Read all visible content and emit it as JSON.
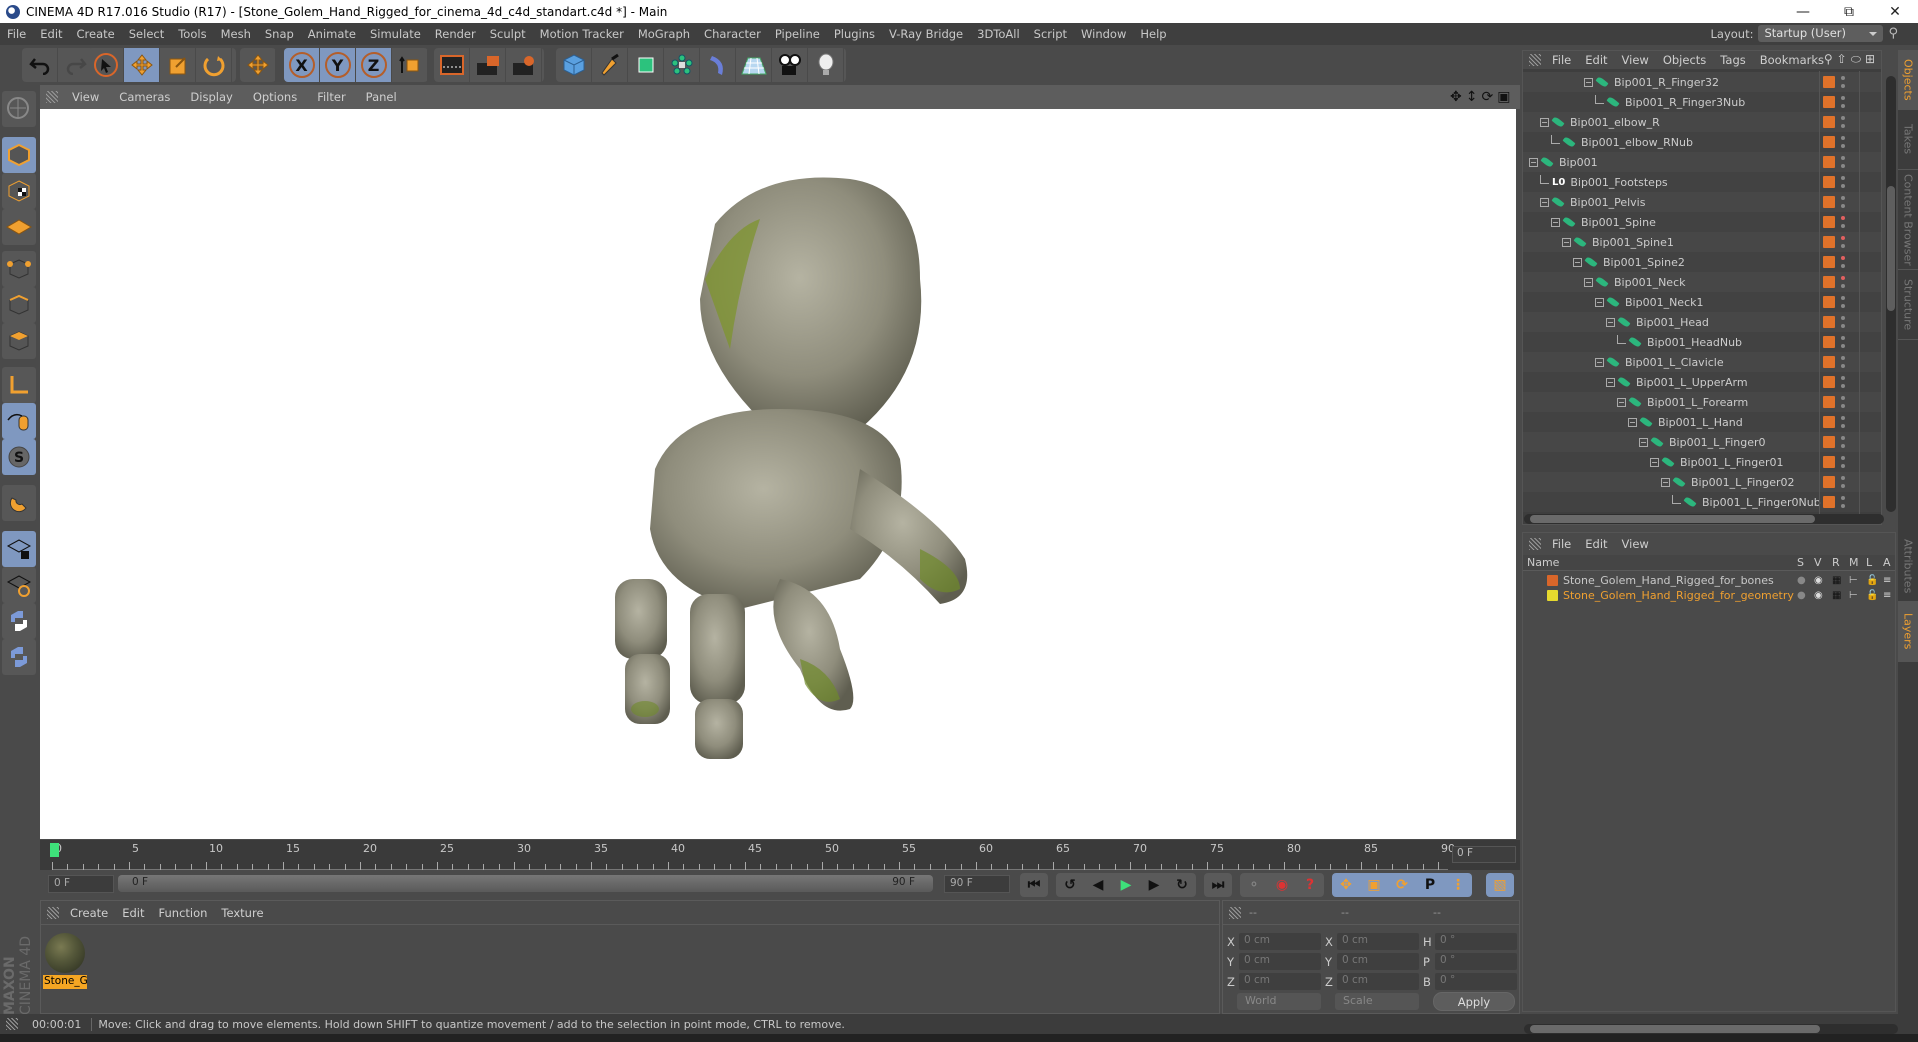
{
  "window": {
    "title": "CINEMA 4D R17.016 Studio (R17) - [Stone_Golem_Hand_Rigged_for_cinema_4d_c4d_standart.c4d *] - Main",
    "controls": [
      "minimize",
      "restore",
      "close"
    ]
  },
  "menubar": [
    "File",
    "Edit",
    "Create",
    "Select",
    "Tools",
    "Mesh",
    "Snap",
    "Animate",
    "Simulate",
    "Render",
    "Sculpt",
    "Motion Tracker",
    "MoGraph",
    "Character",
    "Pipeline",
    "Plugins",
    "V-Ray Bridge",
    "3DToAll",
    "Script",
    "Window",
    "Help"
  ],
  "layout": {
    "label": "Layout:",
    "value": "Startup (User)"
  },
  "toolbar": {
    "groups": [
      {
        "items": [
          "undo-icon",
          "redo-icon"
        ]
      },
      {
        "items": [
          "select-pointer-icon",
          "move-icon",
          "scale-icon",
          "rotate-icon"
        ],
        "active": [
          "move-icon"
        ]
      },
      {
        "items": [
          "last-tool-move-icon"
        ]
      },
      {
        "items": [
          "x-axis-icon",
          "y-axis-icon",
          "z-axis-icon",
          "coordinate-system-icon"
        ],
        "active": [
          "x-axis-icon",
          "y-axis-icon",
          "z-axis-icon"
        ]
      },
      {
        "items": [
          "render-view-icon",
          "render-picture-viewer-icon",
          "render-settings-icon"
        ]
      },
      {
        "items": [
          "cube-icon",
          "pen-spline-icon",
          "subdivision-icon",
          "array-icon",
          "deformer-icon",
          "floor-icon",
          "camera-icon",
          "light-icon"
        ]
      }
    ],
    "labels": {
      "x": "X",
      "y": "Y",
      "z": "Z"
    }
  },
  "lefttools": [
    "make-editable-icon",
    "model-mode-icon",
    "texture-mode-icon",
    "workplane-mode-icon",
    "points-mode-icon",
    "edges-mode-icon",
    "polygons-mode-icon",
    "axis-mode-icon",
    "tweak-mode-icon",
    "solo-icon",
    "snap-magnet-icon",
    "lock-workplane-icon",
    "workplane-align-icon",
    "python-icon",
    "python-script-icon"
  ],
  "viewport": {
    "menu": [
      "View",
      "Cameras",
      "Display",
      "Options",
      "Filter",
      "Panel"
    ],
    "nav_icons": [
      "move-view-icon",
      "zoom-view-icon",
      "rotate-view-icon",
      "toggle-view-icon"
    ]
  },
  "timeline": {
    "ticks": [
      "0",
      "5",
      "10",
      "15",
      "20",
      "25",
      "30",
      "35",
      "40",
      "45",
      "50",
      "55",
      "60",
      "65",
      "70",
      "75",
      "80",
      "85",
      "90"
    ],
    "current_frame": "0 F",
    "start_field": "0 F",
    "range_start": "0 F",
    "range_end": "90 F",
    "end_field": "90 F"
  },
  "material_manager": {
    "menu": [
      "Create",
      "Edit",
      "Function",
      "Texture"
    ],
    "materials": [
      {
        "name": "Stone_G"
      }
    ]
  },
  "brand": {
    "maxon": "MAXON",
    "product": "CINEMA 4D"
  },
  "coordinates": {
    "headers": [
      "--",
      "--",
      "--"
    ],
    "rows": [
      {
        "l1": "X",
        "v1": "0 cm",
        "l2": "X",
        "v2": "0 cm",
        "l3": "H",
        "v3": "0 °"
      },
      {
        "l1": "Y",
        "v1": "0 cm",
        "l2": "Y",
        "v2": "0 cm",
        "l3": "P",
        "v3": "0 °"
      },
      {
        "l1": "Z",
        "v1": "0 cm",
        "l2": "Z",
        "v2": "0 cm",
        "l3": "B",
        "v3": "0 °"
      }
    ],
    "space": "World",
    "mode": "Scale",
    "apply": "Apply"
  },
  "status": {
    "time": "00:00:01",
    "message": "Move: Click and drag to move elements. Hold down SHIFT to quantize movement / add to the selection in point mode, CTRL to remove."
  },
  "object_manager": {
    "menu": [
      "File",
      "Edit",
      "View",
      "Objects",
      "Tags",
      "Bookmarks"
    ],
    "objects": [
      {
        "name": "Bip001_R_Finger32",
        "depth": 5,
        "type": "bone",
        "exp": true,
        "red": false
      },
      {
        "name": "Bip001_R_Finger3Nub",
        "depth": 6,
        "type": "bone",
        "exp": false,
        "red": false
      },
      {
        "name": "Bip001_elbow_R",
        "depth": 1,
        "type": "bone",
        "exp": true,
        "red": false
      },
      {
        "name": "Bip001_elbow_RNub",
        "depth": 2,
        "type": "bone",
        "exp": false,
        "red": false
      },
      {
        "name": "Bip001",
        "depth": 0,
        "type": "bone",
        "exp": true,
        "red": false
      },
      {
        "name": "Bip001_Footsteps",
        "depth": 1,
        "type": "null",
        "exp": false,
        "red": false
      },
      {
        "name": "Bip001_Pelvis",
        "depth": 1,
        "type": "bone",
        "exp": true,
        "red": false
      },
      {
        "name": "Bip001_Spine",
        "depth": 2,
        "type": "bone",
        "exp": true,
        "red": true
      },
      {
        "name": "Bip001_Spine1",
        "depth": 3,
        "type": "bone",
        "exp": true,
        "red": true
      },
      {
        "name": "Bip001_Spine2",
        "depth": 4,
        "type": "bone",
        "exp": true,
        "red": true
      },
      {
        "name": "Bip001_Neck",
        "depth": 5,
        "type": "bone",
        "exp": true,
        "red": true
      },
      {
        "name": "Bip001_Neck1",
        "depth": 6,
        "type": "bone",
        "exp": true,
        "red": false
      },
      {
        "name": "Bip001_Head",
        "depth": 7,
        "type": "bone",
        "exp": true,
        "red": false
      },
      {
        "name": "Bip001_HeadNub",
        "depth": 8,
        "type": "bone",
        "exp": false,
        "red": false
      },
      {
        "name": "Bip001_L_Clavicle",
        "depth": 6,
        "type": "bone",
        "exp": true,
        "red": false
      },
      {
        "name": "Bip001_L_UpperArm",
        "depth": 7,
        "type": "bone",
        "exp": true,
        "red": false
      },
      {
        "name": "Bip001_L_Forearm",
        "depth": 8,
        "type": "bone",
        "exp": true,
        "red": false
      },
      {
        "name": "Bip001_L_Hand",
        "depth": 9,
        "type": "bone",
        "exp": true,
        "red": false
      },
      {
        "name": "Bip001_L_Finger0",
        "depth": 10,
        "type": "bone",
        "exp": true,
        "red": false
      },
      {
        "name": "Bip001_L_Finger01",
        "depth": 11,
        "type": "bone",
        "exp": true,
        "red": false
      },
      {
        "name": "Bip001_L_Finger02",
        "depth": 12,
        "type": "bone",
        "exp": true,
        "red": false
      },
      {
        "name": "Bip001_L_Finger0Nub",
        "depth": 13,
        "type": "bone",
        "exp": false,
        "red": false
      }
    ]
  },
  "layer_manager": {
    "menu": [
      "File",
      "Edit",
      "View"
    ],
    "columns": {
      "name": "Name",
      "s": "S",
      "v": "V",
      "r": "R",
      "m": "M",
      "l": "L",
      "a": "A"
    },
    "layers": [
      {
        "name": "Stone_Golem_Hand_Rigged_for_bones",
        "color": "#d9662a",
        "text_color": "#c8c8c8"
      },
      {
        "name": "Stone_Golem_Hand_Rigged_for_geometry",
        "color": "#e6d92e",
        "text_color": "#f0a030"
      }
    ]
  },
  "side_tabs_top": [
    {
      "label": "Objects",
      "active": true
    },
    {
      "label": "Takes",
      "active": false
    },
    {
      "label": "Content Browser",
      "active": false
    },
    {
      "label": "Structure",
      "active": false
    }
  ],
  "side_tabs_bottom": [
    {
      "label": "Attributes",
      "active": false
    },
    {
      "label": "Layers",
      "active": true
    }
  ],
  "colors": {
    "accent": "#f0a030",
    "active_tool": "#7f98c0",
    "tag_orange": "#e0722a",
    "bone_green": "#2cb67d"
  }
}
